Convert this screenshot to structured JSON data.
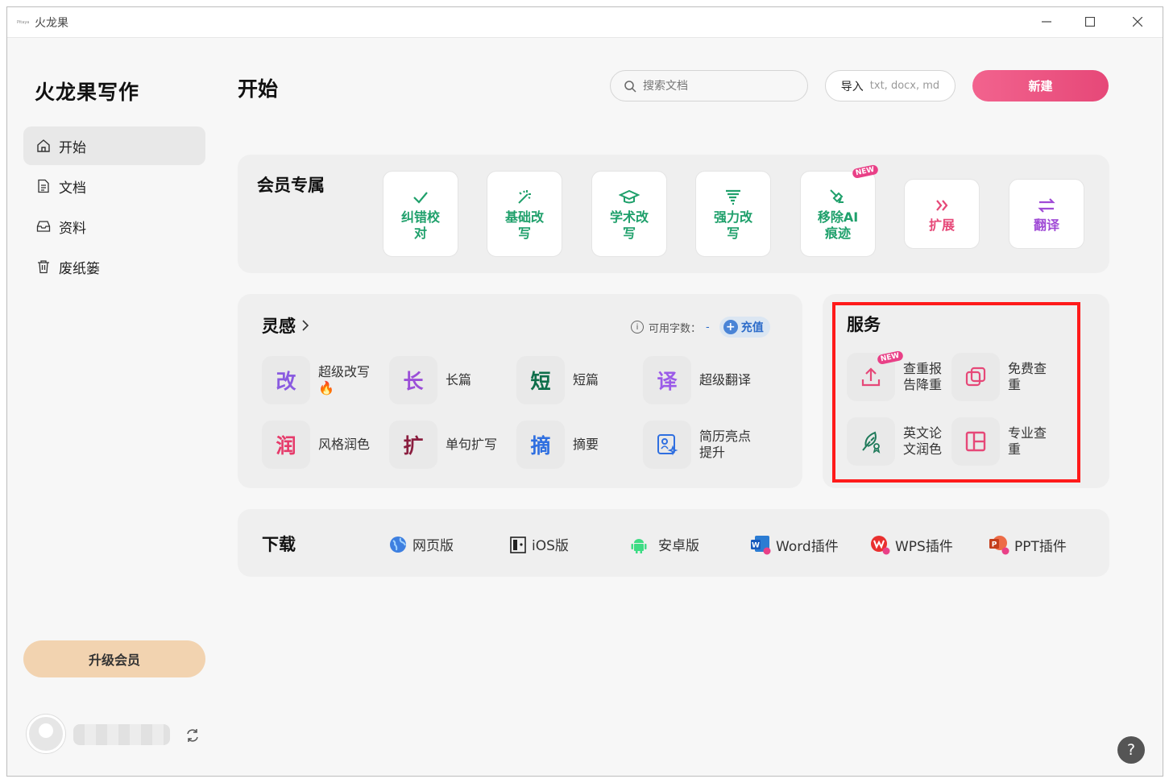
{
  "window": {
    "title": "火龙果",
    "logo_text": "Pitaya"
  },
  "sidebar": {
    "brand": "火龙果写作",
    "items": [
      {
        "label": "开始",
        "icon": "home-icon"
      },
      {
        "label": "文档",
        "icon": "document-icon"
      },
      {
        "label": "资料",
        "icon": "inbox-icon"
      },
      {
        "label": "废纸篓",
        "icon": "trash-icon"
      }
    ],
    "upgrade_label": "升级会员"
  },
  "header": {
    "title": "开始",
    "search_placeholder": "搜索文档",
    "import_label": "导入",
    "import_hint": "txt, docx, md",
    "new_label": "新建"
  },
  "vip": {
    "title": "会员专属",
    "tools": [
      {
        "label": "纠错校对",
        "icon": "check-icon",
        "color": "#1fa06b"
      },
      {
        "label": "基础改写",
        "icon": "sparkle-icon",
        "color": "#1fa06b"
      },
      {
        "label": "学术改写",
        "icon": "graduation-cap-icon",
        "color": "#1fa06b"
      },
      {
        "label": "强力改写",
        "icon": "tornado-icon",
        "color": "#1fa06b"
      },
      {
        "label": "移除AI痕迹",
        "icon": "broom-ai-icon",
        "color": "#1fa06b",
        "badge": "NEW"
      },
      {
        "label": "扩展",
        "icon": "double-chevron-right-icon",
        "color": "#e64878"
      },
      {
        "label": "翻译",
        "icon": "swap-arrows-icon",
        "color": "#a04bd6"
      }
    ]
  },
  "inspiration": {
    "title": "灵感",
    "quota_label": "可用字数：",
    "quota_value": "-",
    "recharge_label": "充值",
    "items": [
      {
        "char": "改",
        "label": "超级改写🔥",
        "color": "#8a5be0"
      },
      {
        "char": "长",
        "label": "长篇",
        "color": "#9b4fd8"
      },
      {
        "char": "短",
        "label": "短篇",
        "color": "#0e6e4a"
      },
      {
        "char": "译",
        "label": "超级翻译",
        "color": "#9b5be8"
      },
      {
        "char": "润",
        "label": "风格润色",
        "color": "#e63b6b"
      },
      {
        "char": "扩",
        "label": "单句扩写",
        "color": "#8a1e3f"
      },
      {
        "char": "摘",
        "label": "摘要",
        "color": "#2f6fe0"
      },
      {
        "char": "",
        "label": "简历亮点提升",
        "color": "#2f6fe0"
      }
    ]
  },
  "service": {
    "title": "服务",
    "items": [
      {
        "label": "查重报告降重",
        "icon": "upload-icon",
        "color": "#e64878",
        "badge": "NEW"
      },
      {
        "label": "免费查重",
        "icon": "copy-squares-icon",
        "color": "#e64878"
      },
      {
        "label": "英文论文润色",
        "icon": "quill-icon",
        "color": "#1f7a5a"
      },
      {
        "label": "专业查重",
        "icon": "layout-panel-icon",
        "color": "#e64878"
      }
    ]
  },
  "download": {
    "title": "下载",
    "items": [
      {
        "label": "网页版",
        "icon": "globe-icon"
      },
      {
        "label": "iOS版",
        "icon": "ios-icon"
      },
      {
        "label": "安卓版",
        "icon": "android-icon"
      },
      {
        "label": "Word插件",
        "icon": "word-icon"
      },
      {
        "label": "WPS插件",
        "icon": "wps-icon"
      },
      {
        "label": "PPT插件",
        "icon": "ppt-icon"
      }
    ]
  },
  "help": {
    "label": "?"
  }
}
